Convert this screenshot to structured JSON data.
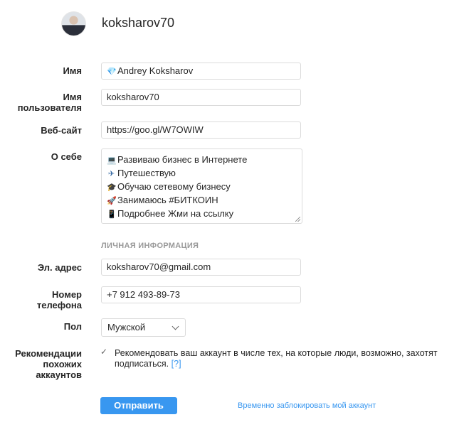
{
  "profile": {
    "username": "koksharov70"
  },
  "form": {
    "name": {
      "label": "Имя",
      "value": "Andrey Koksharov",
      "icon": "diamond-icon"
    },
    "username": {
      "label": "Имя\nпользователя",
      "value": "koksharov70"
    },
    "website": {
      "label": "Веб-сайт",
      "value": "https://goo.gl/W7OWIW"
    },
    "bio": {
      "label": "О себе",
      "lines": [
        {
          "icon": "laptop-icon",
          "glyph": "💻",
          "text": "Развиваю бизнес в Интернете"
        },
        {
          "icon": "airplane-icon",
          "glyph": "✈",
          "text": "Путешествую"
        },
        {
          "icon": "graduation-cap-icon",
          "glyph": "🎓",
          "text": "Обучаю сетевому бизнесу"
        },
        {
          "icon": "rocket-icon",
          "glyph": "🚀",
          "text": "Занимаюсь #БИТКОИН"
        },
        {
          "icon": "phone-icon",
          "glyph": "📱",
          "text": "Подробнее  Жми на ссылку"
        }
      ]
    },
    "personal_section_title": "ЛИЧНАЯ ИНФОРМАЦИЯ",
    "email": {
      "label": "Эл. адрес",
      "value": "koksharov70@gmail.com"
    },
    "phone": {
      "label": "Номер\nтелефона",
      "value": "+7 912 493-89-73"
    },
    "gender": {
      "label": "Пол",
      "value": "Мужской"
    },
    "recommendations": {
      "label": "Рекомендации\nпохожих\nаккаунтов",
      "text": "Рекомендовать ваш аккаунт в числе тех, на которые люди, возможно, захотят подписаться.",
      "help": "[?]",
      "checked": true
    },
    "submit_label": "Отправить",
    "disable_link": "Временно заблокировать мой аккаунт"
  },
  "colors": {
    "accent": "#3897f0",
    "border": "#dbdbdb",
    "muted": "#999999"
  }
}
